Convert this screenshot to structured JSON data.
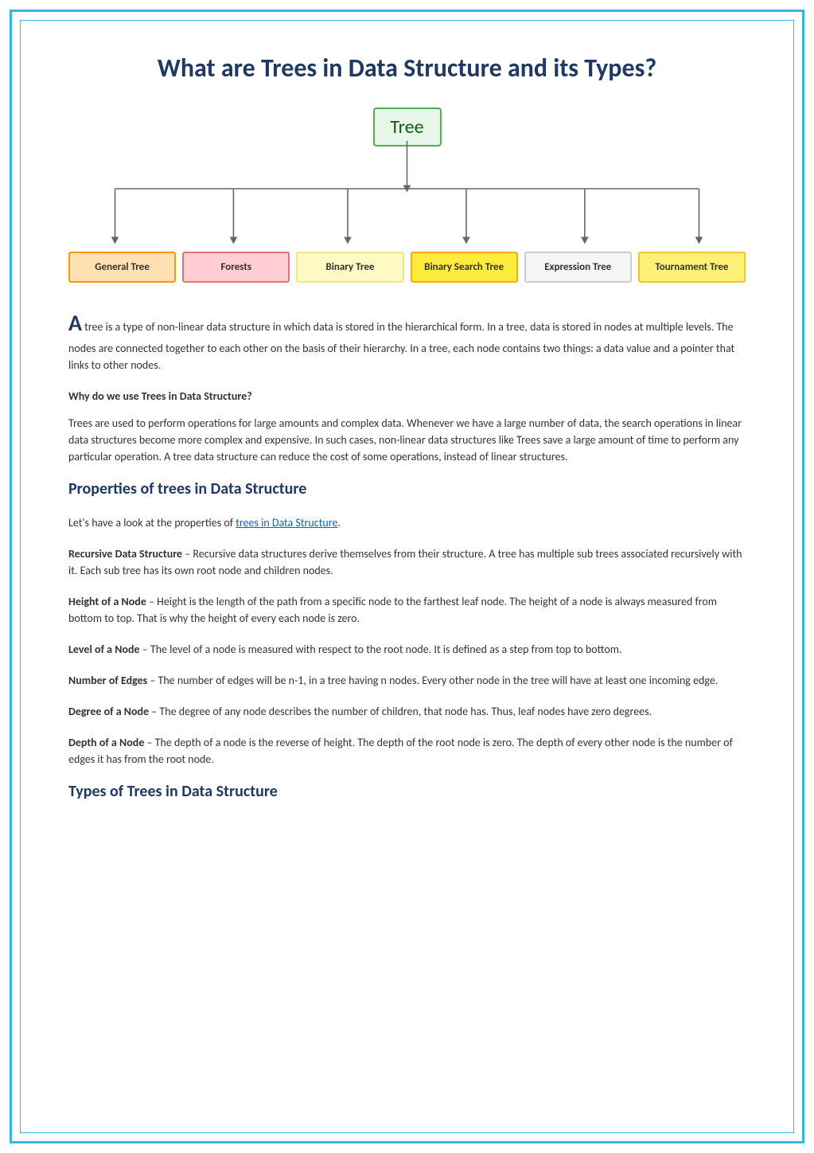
{
  "title": "What are Trees in Data Structure and its Types?",
  "chart_data": {
    "type": "tree-diagram",
    "root": "Tree",
    "children": [
      {
        "label": "General Tree",
        "style": "general-tree"
      },
      {
        "label": "Forests",
        "style": "forests"
      },
      {
        "label": "Binary Tree",
        "style": "binary-tree"
      },
      {
        "label": "Binary Search Tree",
        "style": "binary-search-tree"
      },
      {
        "label": "Expression Tree",
        "style": "expression-tree"
      },
      {
        "label": "Tournament Tree",
        "style": "tournament-tree"
      }
    ]
  },
  "intro": {
    "big_letter": "A",
    "text": " tree is a type of non-linear data structure in which data is stored in the hierarchical form. In a tree, data is stored in nodes at multiple levels. The nodes are connected together to each other on the basis of their hierarchy. In a tree, each node contains two things: a data value and a pointer that links to other nodes."
  },
  "why_heading": "Why do we use Trees in Data Structure?",
  "why_text": "Trees are used to perform operations for large amounts and complex data. Whenever we have a large number of data, the search operations in linear data structures become more complex and expensive. In such cases, non-linear data structures like Trees save a large amount of time to perform any particular operation. A tree data structure can reduce the cost of some operations, instead of linear structures.",
  "properties_heading": "Properties of trees in Data Structure",
  "properties_intro_prefix": "Let's have a look at the properties of ",
  "properties_intro_link": "trees in Data Structure",
  "properties_intro_suffix": ".",
  "properties": [
    {
      "label": "Recursive Data Structure",
      "text": " – Recursive data structures derive themselves from their structure. A tree has multiple sub trees associated recursively with it. Each sub tree has its own root node and children nodes."
    },
    {
      "label": "Height of a Node",
      "text": " – Height is the length of the path from a specific node to the farthest leaf node. The height of a node is always measured from bottom to top. That is why the height of every each node is zero."
    },
    {
      "label": "Level of a Node",
      "text": " – The level of a node is measured with respect to the root node. It is defined as a step from top to bottom."
    },
    {
      "label": "Number of Edges",
      "text": " – The number of edges will be n-1, in a tree having n nodes. Every other node in the tree will have at least one incoming edge."
    },
    {
      "label": "Degree of a Node",
      "text": " – The degree of any node describes the number of children, that node has. Thus, leaf nodes have zero degrees."
    },
    {
      "label": "Depth of a Node",
      "text": " – The depth of a node is the reverse of height. The depth of the root node is zero. The depth of every other node is the number of edges it has from the root node."
    }
  ],
  "types_heading": "Types of Trees in Data Structure"
}
